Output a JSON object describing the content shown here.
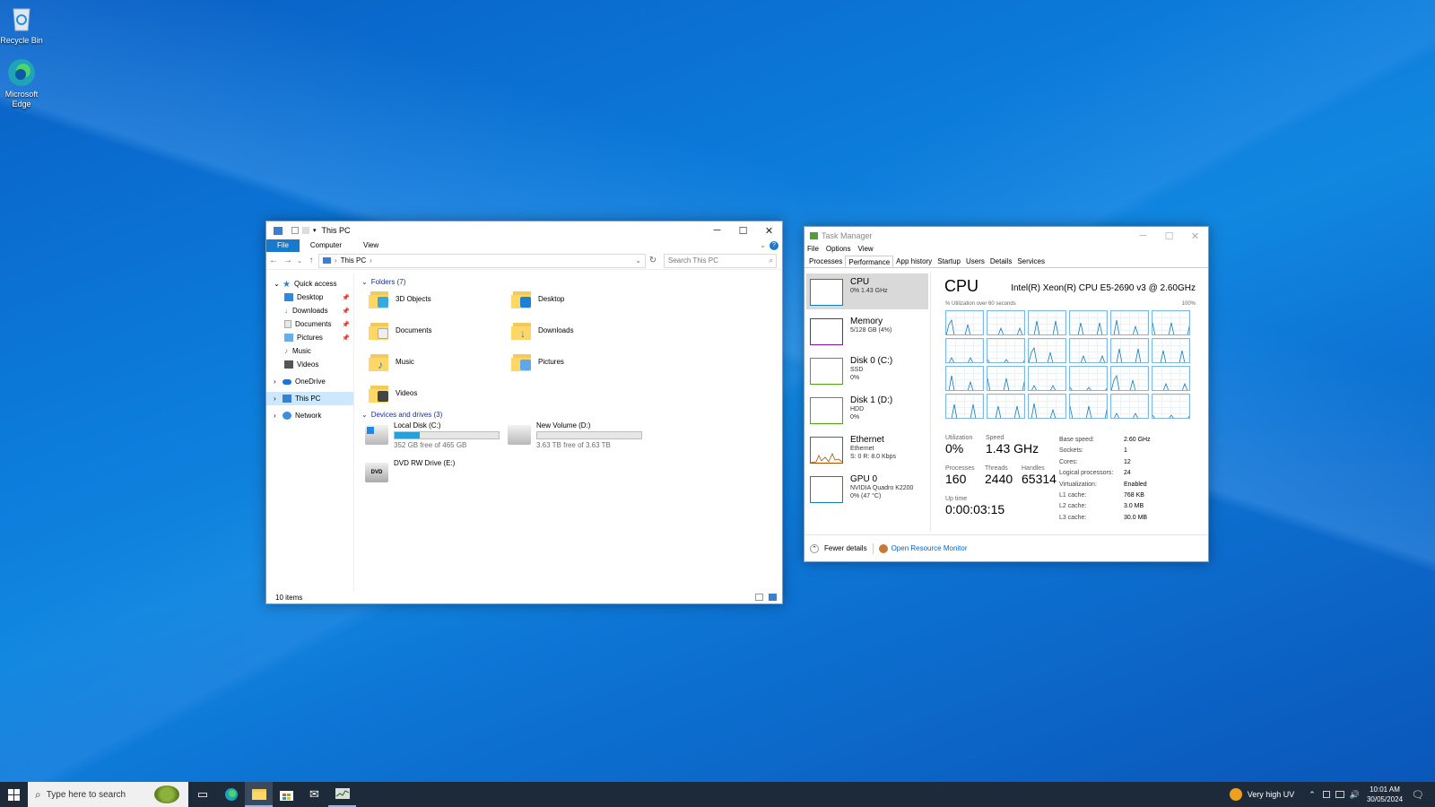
{
  "desktop": {
    "icons": [
      {
        "label": "Recycle Bin",
        "icon": "recycle-bin-icon"
      },
      {
        "label": "Microsoft Edge",
        "icon": "edge-icon"
      }
    ]
  },
  "explorer": {
    "title": "This PC",
    "ribbon_tabs": [
      "File",
      "Computer",
      "View"
    ],
    "address": "This PC",
    "search_placeholder": "Search This PC",
    "nav": {
      "quick_access": "Quick access",
      "items": [
        "Desktop",
        "Downloads",
        "Documents",
        "Pictures",
        "Music",
        "Videos"
      ],
      "onedrive": "OneDrive",
      "this_pc": "This PC",
      "network": "Network"
    },
    "folders_header": "Folders (7)",
    "folders": [
      "3D Objects",
      "Desktop",
      "Documents",
      "Downloads",
      "Music",
      "Pictures",
      "Videos"
    ],
    "drives_header": "Devices and drives (3)",
    "drives": [
      {
        "name": "Local Disk (C:)",
        "free": "352 GB free of 465 GB",
        "used_fraction": 0.24
      },
      {
        "name": "New Volume (D:)",
        "free": "3.63 TB free of 3.63 TB",
        "used_fraction": 0.0
      },
      {
        "name": "DVD RW Drive (E:)"
      }
    ],
    "status": "10 items"
  },
  "taskmgr": {
    "title": "Task Manager",
    "menu": [
      "File",
      "Options",
      "View"
    ],
    "tabs": [
      "Processes",
      "Performance",
      "App history",
      "Startup",
      "Users",
      "Details",
      "Services"
    ],
    "side": [
      {
        "name": "CPU",
        "l1": "0% 1.43 GHz",
        "l2": "",
        "color": "#117dbb"
      },
      {
        "name": "Memory",
        "l1": "5/128 GB (4%)",
        "l2": "",
        "color": "#8b12ae"
      },
      {
        "name": "Disk 0 (C:)",
        "l1": "SSD",
        "l2": "0%",
        "color": "#4da60c"
      },
      {
        "name": "Disk 1 (D:)",
        "l1": "HDD",
        "l2": "0%",
        "color": "#4da60c"
      },
      {
        "name": "Ethernet",
        "l1": "Ethernet",
        "l2": "S: 0 R: 8.0 Kbps",
        "color": "#a74f01"
      },
      {
        "name": "GPU 0",
        "l1": "NVIDIA Quadro K2200",
        "l2": "0% (47 °C)",
        "color": "#117dbb"
      }
    ],
    "cpu_title": "CPU",
    "cpu_model": "Intel(R) Xeon(R) CPU E5-2690 v3 @ 2.60GHz",
    "graph_label": "% Utilization over 60 seconds",
    "graph_max": "100%",
    "stats": {
      "utilization_label": "Utilization",
      "utilization": "0%",
      "speed_label": "Speed",
      "speed": "1.43 GHz",
      "processes_label": "Processes",
      "processes": "160",
      "threads_label": "Threads",
      "threads": "2440",
      "handles_label": "Handles",
      "handles": "65314",
      "uptime_label": "Up time",
      "uptime": "0:00:03:15"
    },
    "specs": [
      [
        "Base speed:",
        "2.60 GHz"
      ],
      [
        "Sockets:",
        "1"
      ],
      [
        "Cores:",
        "12"
      ],
      [
        "Logical processors:",
        "24"
      ],
      [
        "Virtualization:",
        "Enabled"
      ],
      [
        "L1 cache:",
        "768 KB"
      ],
      [
        "L2 cache:",
        "3.0 MB"
      ],
      [
        "L3 cache:",
        "30.0 MB"
      ]
    ],
    "fewer_details": "Fewer details",
    "resource_monitor": "Open Resource Monitor"
  },
  "taskbar": {
    "search_placeholder": "Type here to search",
    "weather": "Very high UV",
    "time": "10:01 AM",
    "date": "30/05/2024"
  }
}
